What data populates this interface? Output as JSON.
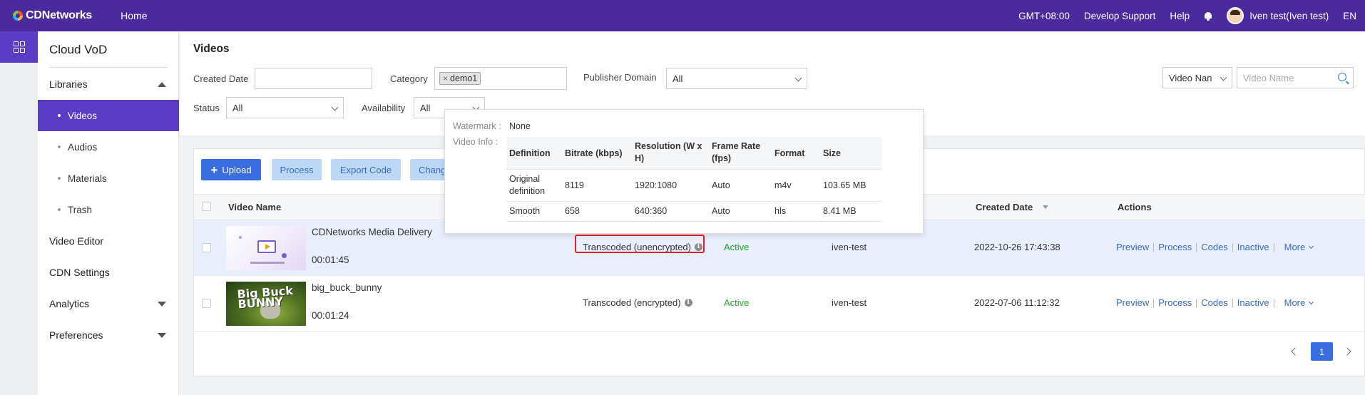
{
  "topbar": {
    "brand": "CDNetworks",
    "home": "Home",
    "timezone": "GMT+08:00",
    "develop_support": "Develop Support",
    "help": "Help",
    "user": "Iven test(Iven test)",
    "lang": "EN",
    "bg_color": "#4b2a9e"
  },
  "sidebar": {
    "title": "Cloud VoD",
    "libraries": "Libraries",
    "sub_items": [
      "Videos",
      "Audios",
      "Materials",
      "Trash"
    ],
    "video_editor": "Video Editor",
    "cdn_settings": "CDN Settings",
    "analytics": "Analytics",
    "preferences": "Preferences",
    "active_color": "#5b3cc4"
  },
  "filters": {
    "page_title": "Videos",
    "created_date_label": "Created Date",
    "created_date_value": "",
    "category_label": "Category",
    "category_tag": "demo1",
    "publisher_domain_label": "Publisher Domain",
    "publisher_domain_value": "All",
    "search_type": "Video Nan",
    "search_placeholder": "Video Name",
    "status_label": "Status",
    "status_value": "All",
    "availability_label": "Availability",
    "availability_value": "All"
  },
  "toolbar": {
    "upload": "Upload",
    "process": "Process",
    "export_code": "Export Code",
    "change": "Chang"
  },
  "table": {
    "headers": {
      "video_name": "Video Name",
      "created_date": "Created Date",
      "actions": "Actions"
    },
    "rows": [
      {
        "name": "CDNetworks Media Delivery",
        "duration": "00:01:45",
        "status": "Transcoded (unencrypted)",
        "availability": "Active",
        "publisher": "iven-test",
        "created": "2022-10-26 17:43:38"
      },
      {
        "name": "big_buck_bunny",
        "duration": "00:01:24",
        "status": "Transcoded (encrypted)",
        "availability": "Active",
        "publisher": "iven-test",
        "created": "2022-07-06 11:12:32",
        "thumb_text": "Big Buck BUNNY"
      }
    ],
    "action_labels": [
      "Preview",
      "Process",
      "Codes",
      "Inactive",
      "More"
    ]
  },
  "pagination": {
    "current": "1"
  },
  "popover": {
    "watermark_label": "Watermark :",
    "watermark_value": "None",
    "video_info_label": "Video Info :",
    "headers": [
      "Definition",
      "Bitrate (kbps)",
      "Resolution (W x H)",
      "Frame Rate (fps)",
      "Format",
      "Size"
    ],
    "rows": [
      [
        "Original definition",
        "8119",
        "1920:1080",
        "Auto",
        "m4v",
        "103.65 MB"
      ],
      [
        "Smooth",
        "658",
        "640:360",
        "Auto",
        "hls",
        "8.41 MB"
      ]
    ]
  },
  "colors": {
    "primary": "#3a6de0",
    "active_green": "#23a32a",
    "highlight_border": "#e0202a"
  }
}
